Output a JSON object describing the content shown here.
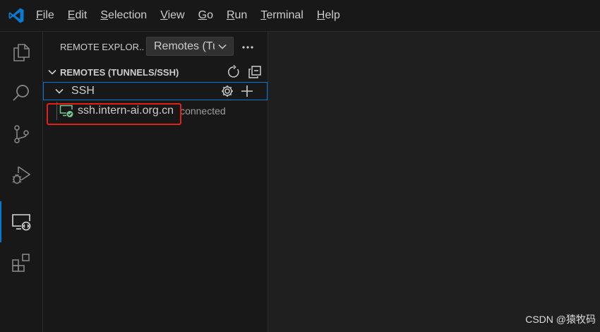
{
  "menu": {
    "items": [
      {
        "accel": "F",
        "rest": "ile"
      },
      {
        "accel": "E",
        "rest": "dit"
      },
      {
        "accel": "S",
        "rest": "election"
      },
      {
        "accel": "V",
        "rest": "iew"
      },
      {
        "accel": "G",
        "rest": "o"
      },
      {
        "accel": "R",
        "rest": "un"
      },
      {
        "accel": "T",
        "rest": "erminal"
      },
      {
        "accel": "H",
        "rest": "elp"
      }
    ]
  },
  "activity_bar": {
    "icons": [
      "explorer-icon",
      "search-icon",
      "source-control-icon",
      "run-debug-icon",
      "remote-explorer-icon",
      "extensions-icon"
    ],
    "active": "remote-explorer-icon",
    "accent": "#0078d4"
  },
  "sidebar": {
    "title": "REMOTE EXPLOR...",
    "remotes_select": {
      "value": "Remotes (Tunnels/SSH)",
      "display": "Remotes (Tu"
    },
    "section": {
      "title": "REMOTES (TUNNELS/SSH)",
      "actions": [
        "refresh-icon",
        "collapse-all-icon"
      ]
    },
    "ssh_group": {
      "label": "SSH",
      "actions": [
        "settings-gear-icon",
        "add-icon"
      ]
    },
    "hosts": [
      {
        "name": "ssh.intern-ai.org.cn",
        "status": "connected",
        "icon": "remote-connected-icon",
        "status_color": "#73c991"
      }
    ]
  },
  "highlight_color": "#e0201b",
  "watermark": "CSDN @猿牧码"
}
